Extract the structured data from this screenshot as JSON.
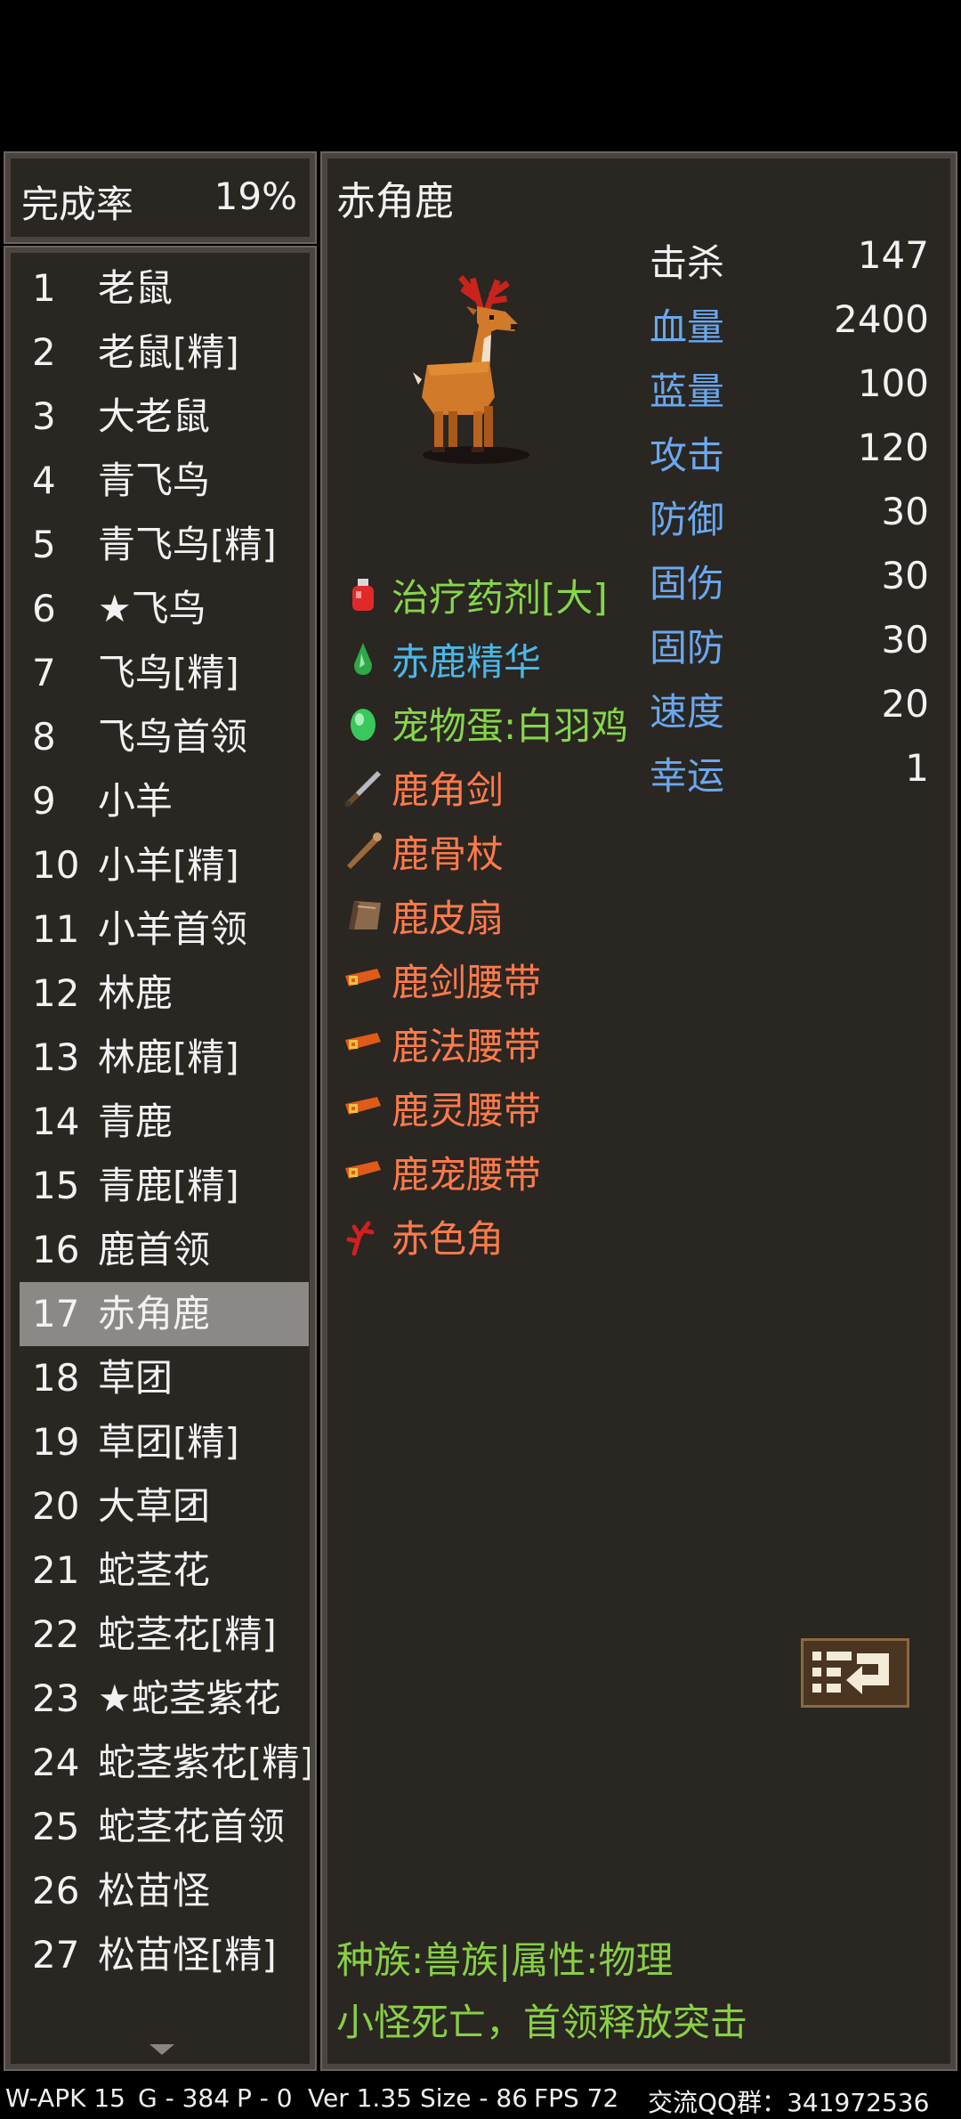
{
  "completion": {
    "label": "完成率",
    "value": "19%"
  },
  "list": [
    {
      "num": "1",
      "name": "老鼠"
    },
    {
      "num": "2",
      "name": "老鼠[精]"
    },
    {
      "num": "3",
      "name": "大老鼠"
    },
    {
      "num": "4",
      "name": "青飞鸟"
    },
    {
      "num": "5",
      "name": "青飞鸟[精]"
    },
    {
      "num": "6",
      "name": "★飞鸟"
    },
    {
      "num": "7",
      "name": "飞鸟[精]"
    },
    {
      "num": "8",
      "name": "飞鸟首领"
    },
    {
      "num": "9",
      "name": "小羊"
    },
    {
      "num": "10",
      "name": "小羊[精]"
    },
    {
      "num": "11",
      "name": "小羊首领"
    },
    {
      "num": "12",
      "name": "林鹿"
    },
    {
      "num": "13",
      "name": "林鹿[精]"
    },
    {
      "num": "14",
      "name": "青鹿"
    },
    {
      "num": "15",
      "name": "青鹿[精]"
    },
    {
      "num": "16",
      "name": "鹿首领"
    },
    {
      "num": "17",
      "name": "赤角鹿"
    },
    {
      "num": "18",
      "name": "草团"
    },
    {
      "num": "19",
      "name": "草团[精]"
    },
    {
      "num": "20",
      "name": "大草团"
    },
    {
      "num": "21",
      "name": "蛇茎花"
    },
    {
      "num": "22",
      "name": "蛇茎花[精]"
    },
    {
      "num": "23",
      "name": "★蛇茎紫花"
    },
    {
      "num": "24",
      "name": "蛇茎紫花[精]"
    },
    {
      "num": "25",
      "name": "蛇茎花首领"
    },
    {
      "num": "26",
      "name": "松苗怪"
    },
    {
      "num": "27",
      "name": "松苗怪[精]"
    }
  ],
  "selected_index": 16,
  "monster": {
    "name": "赤角鹿",
    "stats": [
      {
        "label": "击杀",
        "value": "147",
        "color": "white"
      },
      {
        "label": "血量",
        "value": "2400",
        "color": "blue"
      },
      {
        "label": "蓝量",
        "value": "100",
        "color": "blue"
      },
      {
        "label": "攻击",
        "value": "120",
        "color": "blue"
      },
      {
        "label": "防御",
        "value": "30",
        "color": "blue"
      },
      {
        "label": "固伤",
        "value": "30",
        "color": "blue"
      },
      {
        "label": "固防",
        "value": "30",
        "color": "blue"
      },
      {
        "label": "速度",
        "value": "20",
        "color": "blue"
      },
      {
        "label": "幸运",
        "value": "1",
        "color": "blue"
      }
    ],
    "drops": [
      {
        "name": "治疗药剂[大]",
        "icon": "potion-icon",
        "color": "#86d64a"
      },
      {
        "name": "赤鹿精华",
        "icon": "essence-icon",
        "color": "#4ab8e8"
      },
      {
        "name": "宠物蛋:白羽鸡",
        "icon": "egg-icon",
        "color": "#86d64a"
      },
      {
        "name": "鹿角剑",
        "icon": "sword-icon",
        "color": "#ff7a4a"
      },
      {
        "name": "鹿骨杖",
        "icon": "staff-icon",
        "color": "#ff7a4a"
      },
      {
        "name": "鹿皮扇",
        "icon": "fan-icon",
        "color": "#ff7a4a"
      },
      {
        "name": "鹿剑腰带",
        "icon": "belt-icon",
        "color": "#ff7a4a"
      },
      {
        "name": "鹿法腰带",
        "icon": "belt-icon",
        "color": "#ff7a4a"
      },
      {
        "name": "鹿灵腰带",
        "icon": "belt-icon",
        "color": "#ff7a4a"
      },
      {
        "name": "鹿宠腰带",
        "icon": "belt-icon",
        "color": "#ff7a4a"
      },
      {
        "name": "赤色角",
        "icon": "horn-icon",
        "color": "#ff7a4a"
      }
    ],
    "race": "种族:兽族|属性:物理",
    "skill": "小怪死亡，首领释放突击"
  },
  "status_bar": {
    "apk": "W-APK 15",
    "g": "G - 384",
    "p": "P - 0",
    "ver": "Ver 1.35",
    "size": "Size - 86",
    "fps": "FPS 72",
    "qq": "交流QQ群：341972536"
  }
}
